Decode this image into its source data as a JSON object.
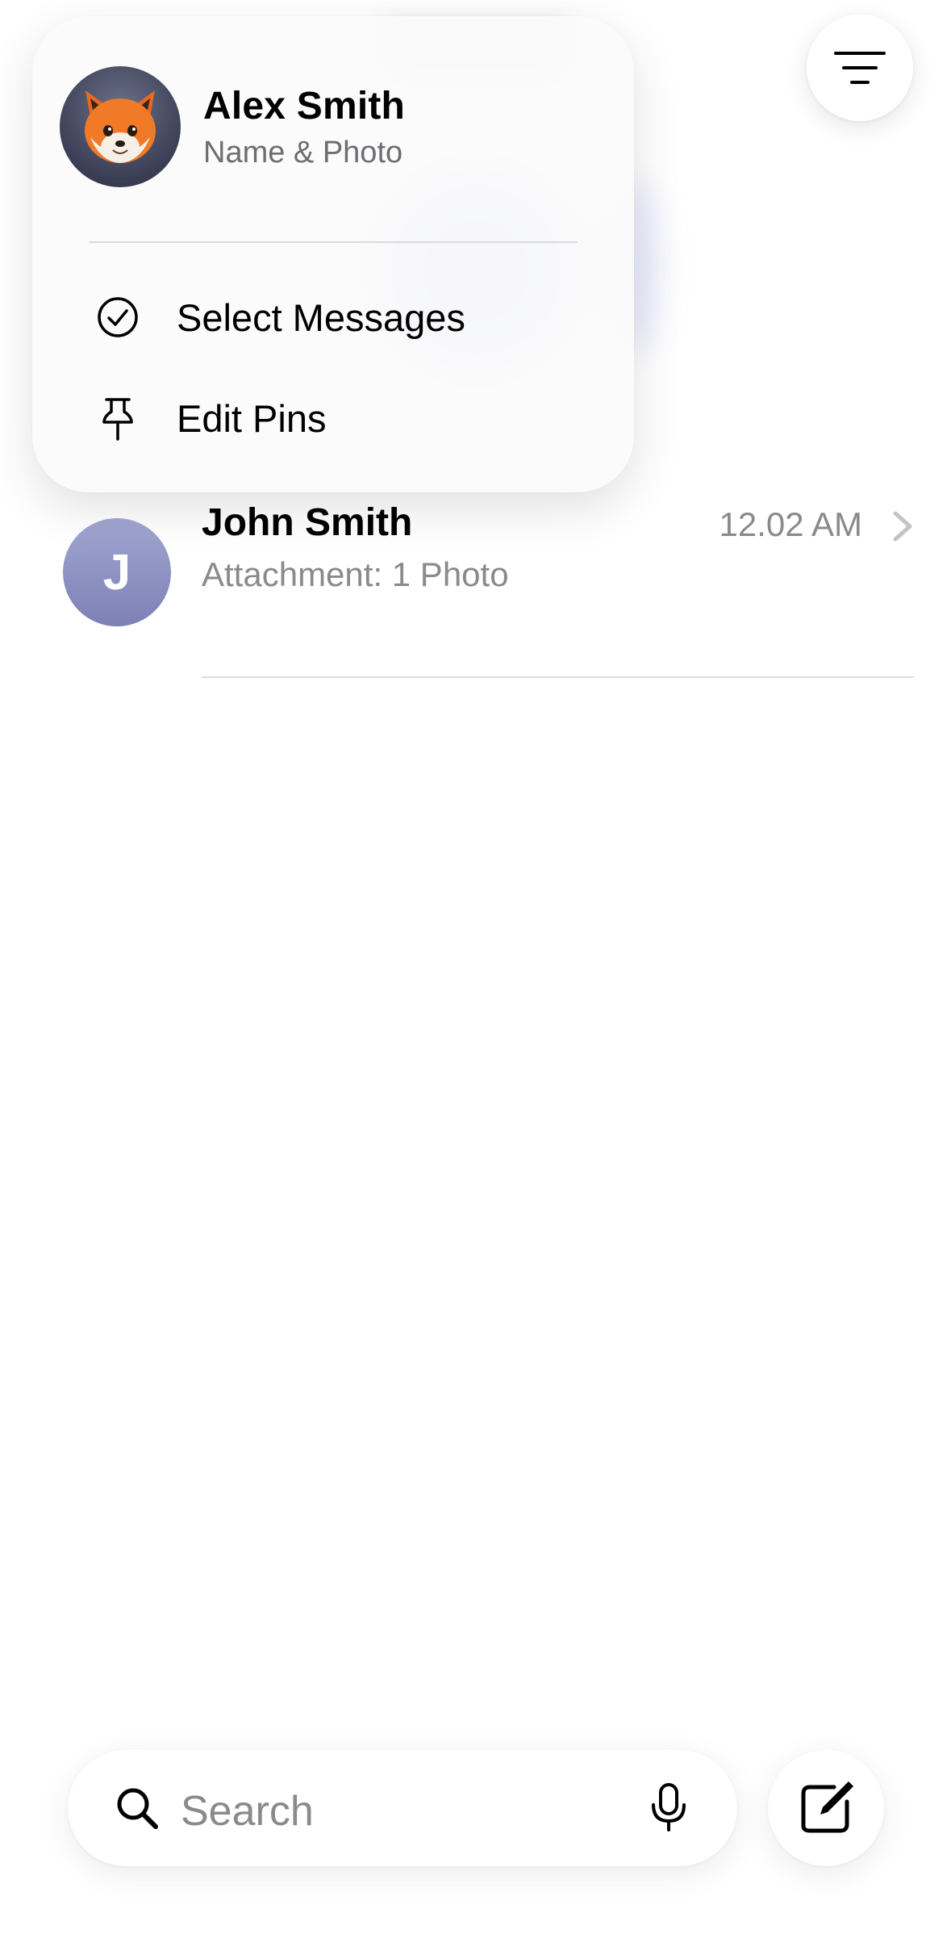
{
  "menu": {
    "profile_name": "Alex Smith",
    "profile_sub": "Name & Photo",
    "avatar_icon": "fox-memoji-icon",
    "items": [
      {
        "label": "Select Messages",
        "icon": "checkmark-circle-icon"
      },
      {
        "label": "Edit Pins",
        "icon": "pin-icon"
      }
    ]
  },
  "toolbar": {
    "filter_icon": "filter-lines-icon"
  },
  "conversations": [
    {
      "initial": "J",
      "name": "John Smith",
      "preview": "Attachment: 1 Photo",
      "time": "12.02 AM"
    }
  ],
  "search": {
    "placeholder": "Search",
    "icon": "search-icon",
    "mic_icon": "microphone-icon"
  },
  "compose": {
    "icon": "compose-icon"
  },
  "colors": {
    "avatar_gradient_top": "#a2a7d3",
    "avatar_gradient_bottom": "#7c80b4",
    "secondary_text": "#8a8a8e"
  }
}
